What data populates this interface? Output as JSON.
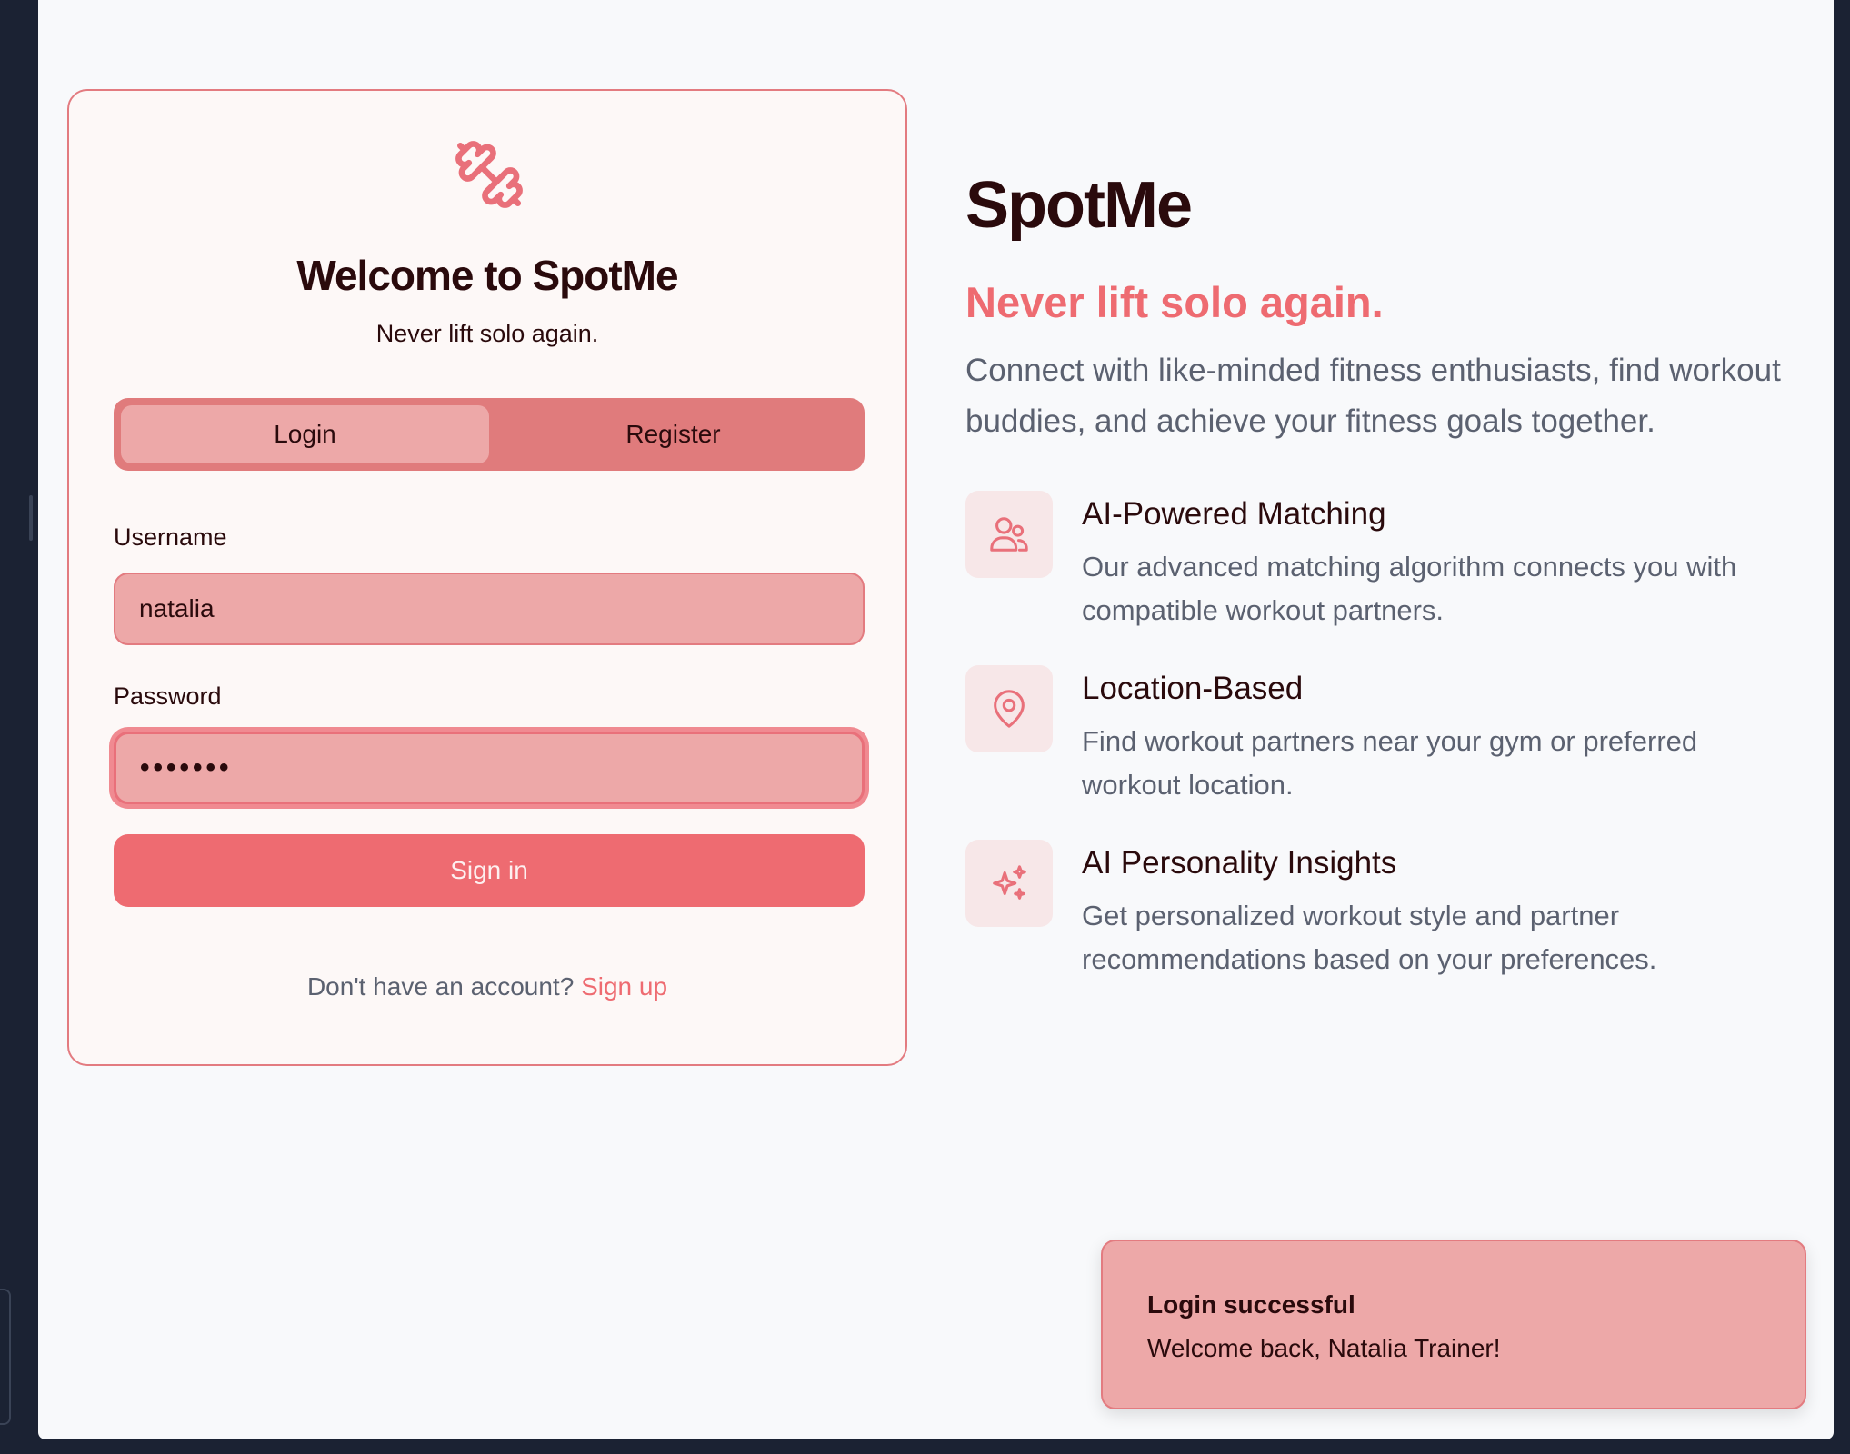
{
  "card": {
    "logo_icon": "dumbbell-icon",
    "title": "Welcome to SpotMe",
    "subtitle": "Never lift solo again.",
    "tabs": [
      {
        "label": "Login",
        "active": true
      },
      {
        "label": "Register",
        "active": false
      }
    ],
    "username": {
      "label": "Username",
      "value": "natalia"
    },
    "password": {
      "label": "Password",
      "value": "•••••••"
    },
    "signin_label": "Sign in",
    "signup_prompt": "Don't have an account?",
    "signup_link": "Sign up"
  },
  "hero": {
    "brand": "SpotMe",
    "tagline": "Never lift solo again.",
    "description": "Connect with like-minded fitness enthusiasts, find workout buddies, and achieve your fitness goals together.",
    "features": [
      {
        "icon": "users-icon",
        "title": "AI-Powered Matching",
        "description": "Our advanced matching algorithm connects you with compatible workout partners."
      },
      {
        "icon": "map-pin-icon",
        "title": "Location-Based",
        "description": "Find workout partners near your gym or preferred workout location."
      },
      {
        "icon": "sparkles-icon",
        "title": "AI Personality Insights",
        "description": "Get personalized workout style and partner recommendations based on your preferences."
      }
    ]
  },
  "toast": {
    "title": "Login successful",
    "message": "Welcome back, Natalia Trainer!"
  },
  "colors": {
    "accent": "#ee6b71",
    "accent_light": "#eda8a8",
    "tab_bg": "#e07b7c",
    "card_bg": "#fdf8f7",
    "page_bg": "#f8f9fb",
    "heading": "#2a0a0c",
    "muted_text": "#5b6170"
  }
}
